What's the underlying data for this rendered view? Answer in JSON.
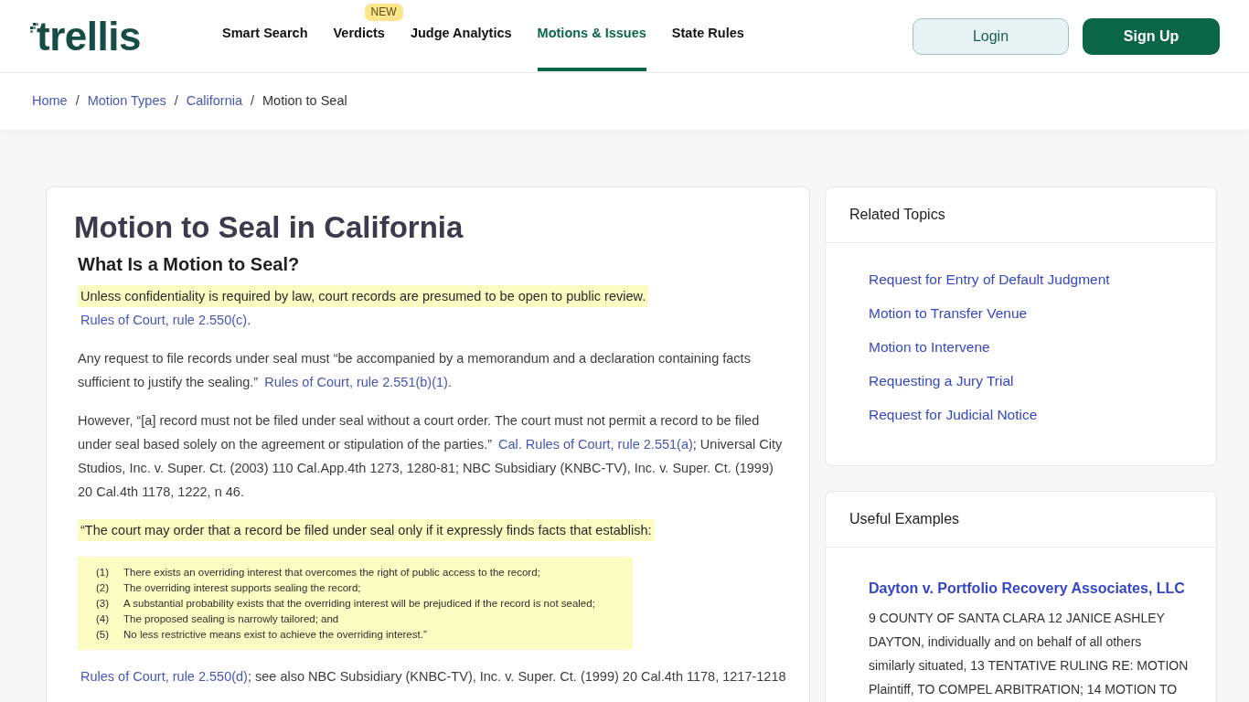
{
  "header": {
    "logo": "trellis",
    "nav": [
      {
        "label": "Smart Search",
        "selected": false
      },
      {
        "label": "Verdicts",
        "selected": false,
        "badge": "NEW"
      },
      {
        "label": "Judge Analytics",
        "selected": false
      },
      {
        "label": "Motions & Issues",
        "selected": true
      },
      {
        "label": "State Rules",
        "selected": false
      }
    ],
    "buttons": [
      {
        "label": "Login",
        "kind": "secondary"
      },
      {
        "label": "Sign Up",
        "kind": "primary"
      }
    ]
  },
  "breadcrumb": [
    {
      "kind": "link",
      "text": "Home"
    },
    {
      "kind": "separator",
      "text": "/"
    },
    {
      "kind": "link",
      "text": "Motion Types"
    },
    {
      "kind": "separator",
      "text": "/"
    },
    {
      "kind": "link",
      "text": "California"
    },
    {
      "kind": "separator",
      "text": "/"
    },
    {
      "kind": "current",
      "text": "Motion to Seal"
    }
  ],
  "article": {
    "title": "Motion to Seal in California",
    "heading": "What Is a Motion to Seal?",
    "blocks": [
      {
        "kind": "paragraph",
        "segments": [
          {
            "kind": "highlight",
            "text": "Unless confidentiality is required by law, court records are presumed to be open to public review. "
          },
          {
            "kind": "link",
            "text": "Rules of Court, rule 2.550(c)"
          },
          {
            "kind": "text",
            "text": "."
          }
        ]
      },
      {
        "kind": "paragraph",
        "segments": [
          {
            "kind": "text",
            "text": "Any request to file records under seal must “be accompanied by a memorandum and a declaration containing facts sufficient to justify the sealing.” "
          },
          {
            "kind": "link",
            "text": "Rules of Court, rule 2.551(b)(1)"
          },
          {
            "kind": "text",
            "text": "."
          }
        ]
      },
      {
        "kind": "paragraph",
        "segments": [
          {
            "kind": "text",
            "text": "However, “[a] record must not be filed under seal without a court order. The court must not permit a record to be filed under seal based solely on the agreement or stipulation of the parties.” "
          },
          {
            "kind": "link",
            "text": "Cal. Rules of Court, rule 2.551(a)"
          },
          {
            "kind": "text",
            "text": "; Universal City Studios, Inc. v. Super. Ct. (2003) 110 Cal.App.4th 1273, 1280-81; NBC Subsidiary (KNBC-TV), Inc. v. Super. Ct. (1999) 20 Cal.4th 1178, 1222, n 46."
          }
        ]
      },
      {
        "kind": "paragraph",
        "segments": [
          {
            "kind": "highlight",
            "text": "“The court may order that a record be filed under seal only if it expressly finds facts that establish:"
          }
        ]
      },
      {
        "kind": "list",
        "items": [
          {
            "number": "(1)",
            "text": "There exists an overriding interest that overcomes the right of public access to the record;"
          },
          {
            "number": "(2)",
            "text": "The overriding interest supports sealing the record;"
          },
          {
            "number": "(3)",
            "text": "A substantial probability exists that the overriding interest will be prejudiced if the record is not sealed;"
          },
          {
            "number": "(4)",
            "text": "The proposed sealing is narrowly tailored; and"
          },
          {
            "number": "(5)",
            "text": "No less restrictive means exist to achieve the overriding interest.”"
          }
        ]
      },
      {
        "kind": "paragraph",
        "segments": [
          {
            "kind": "link",
            "text": "Rules of Court, rule 2.550(d)"
          },
          {
            "kind": "text",
            "text": "; see also NBC Subsidiary (KNBC-TV), Inc. v. Super. Ct. (1999) 20 Cal.4th 1178, 1217-1218"
          }
        ]
      }
    ]
  },
  "related_topics": {
    "title": "Related Topics",
    "links": [
      "Request for Entry of Default Judgment",
      "Motion to Transfer Venue",
      "Motion to Intervene",
      "Requesting a Jury Trial",
      "Request for Judicial Notice"
    ]
  },
  "useful_examples": {
    "title": "Useful Examples",
    "examples": [
      {
        "title": "Dayton v. Portfolio Recovery Associates, LLC",
        "excerpt": "9 COUNTY OF SANTA CLARA 12 JANICE ASHLEY DAYTON, individually and on behalf of all others similarly situated, 13 TENTATIVE RULING RE: MOTION Plaintiff, TO COMPEL ARBITRATION; 14 MOTION TO"
      }
    ]
  }
}
